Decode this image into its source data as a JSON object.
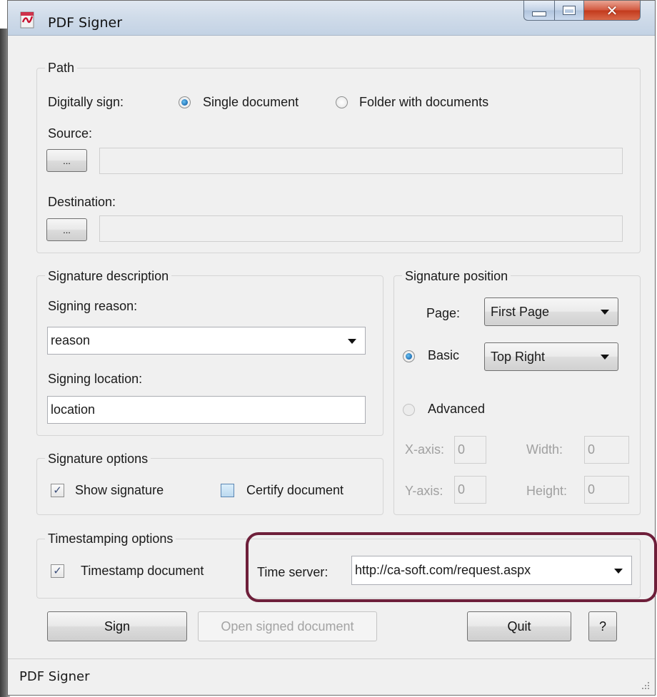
{
  "window": {
    "title": "PDF Signer",
    "icon": "pdf-app-icon",
    "controls": [
      "minimize-icon",
      "maximize-icon",
      "close-icon"
    ]
  },
  "path": {
    "group_label": "Path",
    "sign_label": "Digitally sign:",
    "options": [
      {
        "label": "Single document",
        "checked": true
      },
      {
        "label": "Folder with documents",
        "checked": false
      }
    ],
    "source_label": "Source:",
    "source_value": "",
    "destination_label": "Destination:",
    "destination_value": "",
    "browse_label": "..."
  },
  "description": {
    "group_label": "Signature description",
    "reason_label": "Signing reason:",
    "reason_value": "reason",
    "location_label": "Signing location:",
    "location_value": "location"
  },
  "position": {
    "group_label": "Signature position",
    "page_label": "Page:",
    "page_value": "First Page",
    "basic_label": "Basic",
    "basic_value": "Top Right",
    "advanced_label": "Advanced",
    "mode": "Basic",
    "xaxis_label": "X-axis:",
    "xaxis_value": "0",
    "yaxis_label": "Y-axis:",
    "yaxis_value": "0",
    "width_label": "Width:",
    "width_value": "0",
    "height_label": "Height:",
    "height_value": "0"
  },
  "options": {
    "group_label": "Signature options",
    "show_signature_label": "Show signature",
    "show_signature": true,
    "certify_label": "Certify document",
    "certify": false
  },
  "timestamp": {
    "group_label": "Timestamping options",
    "timestamp_label": "Timestamp document",
    "timestamp": true,
    "server_label": "Time server:",
    "server_value": "http://ca-soft.com/request.aspx"
  },
  "actions": {
    "sign": "Sign",
    "open_signed": "Open signed document",
    "quit": "Quit",
    "help": "?"
  },
  "status": {
    "text": "PDF Signer"
  },
  "colors": {
    "window_bg": "#f0f0f0",
    "highlight": "#6e1f3a",
    "close_button": "#c2391c"
  }
}
